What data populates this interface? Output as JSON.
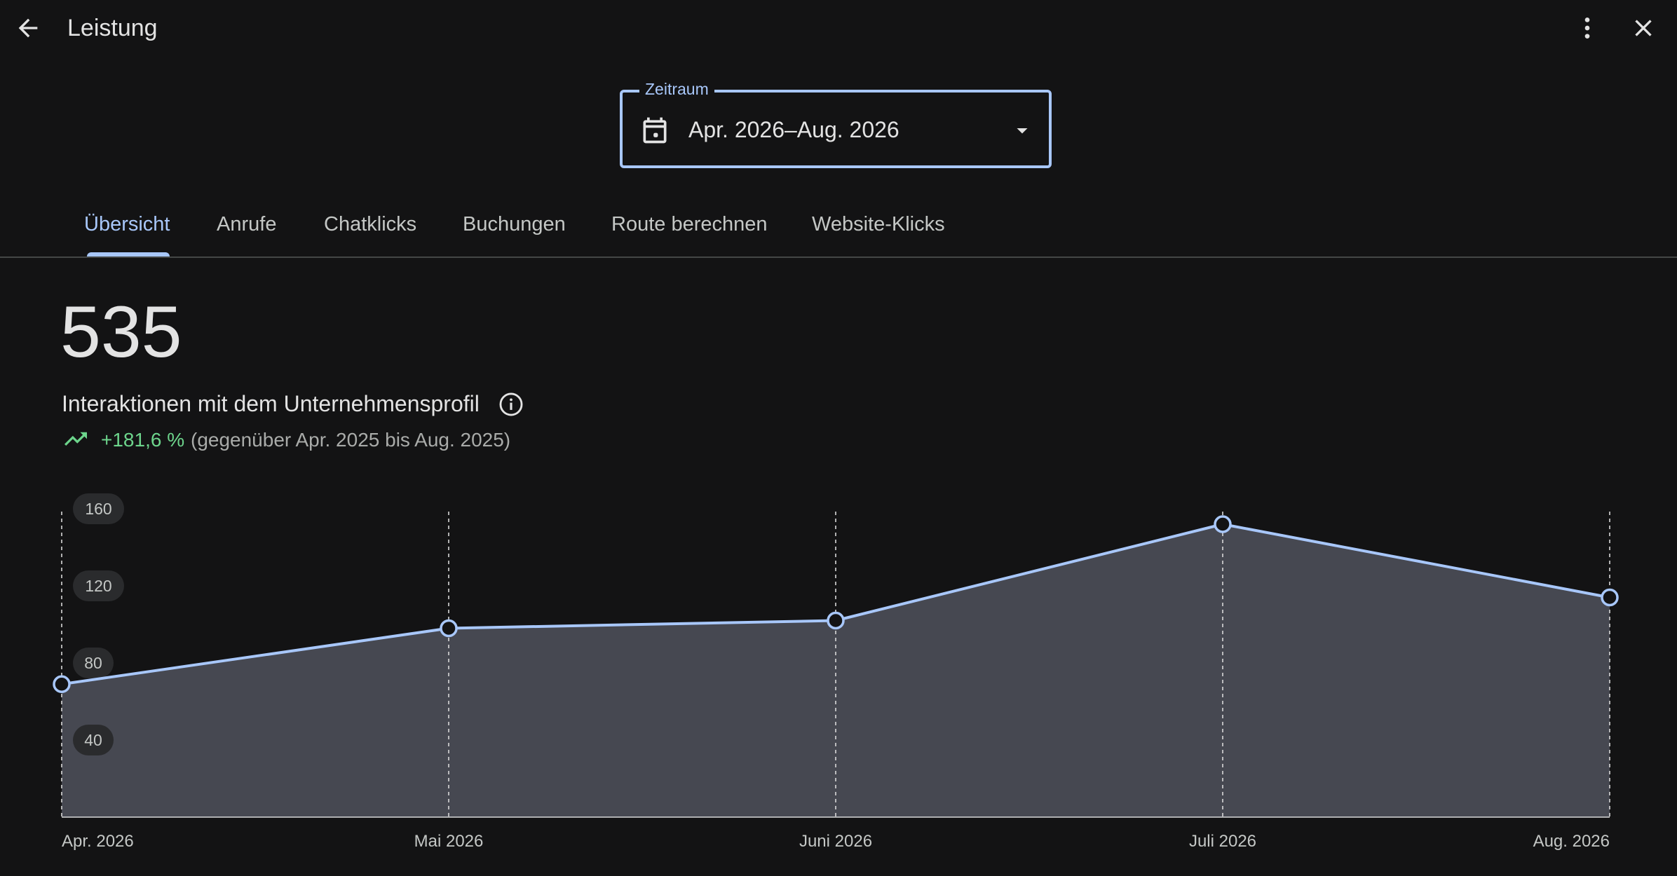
{
  "header": {
    "title": "Leistung",
    "back_icon": "arrow-back-icon",
    "more_icon": "more-vert-icon",
    "close_icon": "close-icon"
  },
  "date_range": {
    "label": "Zeitraum",
    "value": "Apr. 2026–Aug. 2026",
    "icon": "calendar-icon",
    "dropdown_icon": "caret-down-icon"
  },
  "tabs": [
    {
      "label": "Übersicht",
      "active": true
    },
    {
      "label": "Anrufe",
      "active": false
    },
    {
      "label": "Chatklicks",
      "active": false
    },
    {
      "label": "Buchungen",
      "active": false
    },
    {
      "label": "Route berechnen",
      "active": false
    },
    {
      "label": "Website-Klicks",
      "active": false
    }
  ],
  "metric": {
    "value": "535",
    "label": "Interaktionen mit dem Unternehmensprofil",
    "info_icon": "info-icon",
    "trend_icon": "trending-up-icon",
    "change": "+181,6 %",
    "comparison": "(gegenüber Apr. 2025 bis Aug. 2025)"
  },
  "colors": {
    "background": "#131314",
    "accent": "#a8c7fa",
    "positive": "#6dd58c",
    "area_fill": "#464851",
    "text": "#e3e3e3",
    "muted_text": "#a9aba9"
  },
  "chart_data": {
    "type": "area",
    "categories": [
      "Apr. 2026",
      "Mai 2026",
      "Juni 2026",
      "Juli 2026",
      "Aug. 2026"
    ],
    "values": [
      69,
      98,
      102,
      152,
      114
    ],
    "yticks": [
      40,
      80,
      120,
      160
    ],
    "ylim": [
      0,
      160
    ],
    "grid": "vertical-dashed",
    "legend": "none"
  }
}
